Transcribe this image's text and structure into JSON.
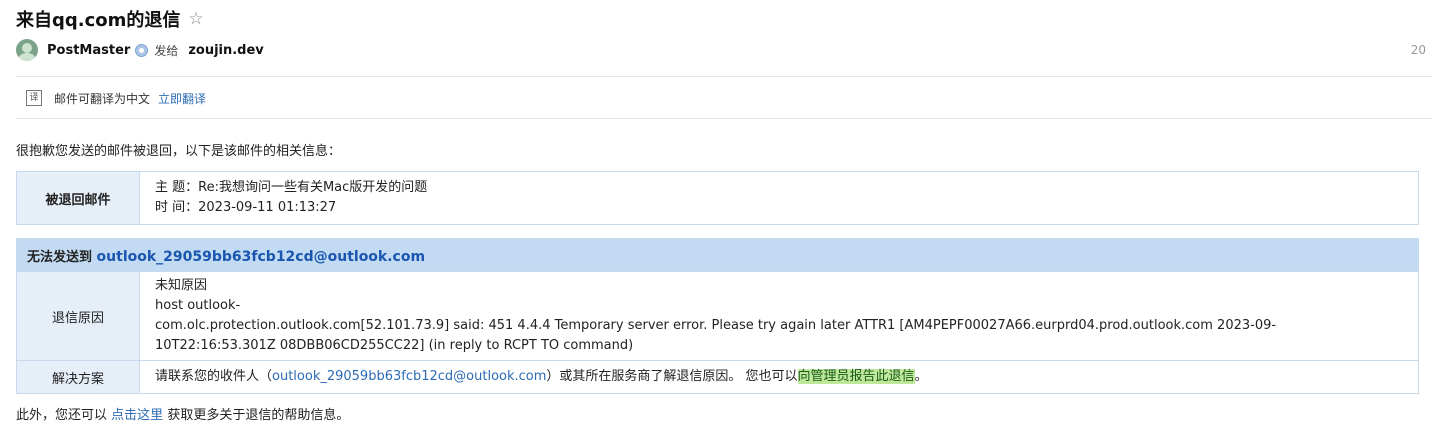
{
  "header": {
    "subject": "来自qq.com的退信",
    "star_icon": "☆",
    "sender_name": "PostMaster",
    "to_label": "发给",
    "recipient": "zoujin.dev",
    "date_partial": "20"
  },
  "translate_bar": {
    "text": "邮件可翻译为中文",
    "link": "立即翻译"
  },
  "body": {
    "intro": "很抱歉您发送的邮件被退回，以下是该邮件的相关信息：",
    "returned_mail": {
      "label": "被退回邮件",
      "subject_line": "主 题：Re:我想询问一些有关Mac版开发的问题",
      "time_line": "时 间：2023-09-11 01:13:27"
    },
    "failure": {
      "header_prefix": "无法发送到",
      "address": "outlook_29059bb63fcb12cd@outlook.com",
      "reason_label": "退信原因",
      "reason_lines": [
        "未知原因",
        "host outlook-",
        "com.olc.protection.outlook.com[52.101.73.9] said: 451 4.4.4 Temporary server error. Please try again later ATTR1 [AM4PEPF00027A66.eurprd04.prod.outlook.com 2023-09-",
        "10T22:16:53.301Z 08DBB06CD255CC22] (in reply to RCPT TO command)"
      ],
      "solution_label": "解决方案",
      "solution_prefix": "请联系您的收件人（",
      "solution_address": "outlook_29059bb63fcb12cd@outlook.com",
      "solution_middle": "）或其所在服务商了解退信原因。 您也可以",
      "solution_link": "向管理员报告此退信",
      "solution_end": "。"
    },
    "footer_prefix": "此外，您还可以",
    "footer_link": "点击这里",
    "footer_suffix": "获取更多关于退信的帮助信息。"
  },
  "colors": {
    "link": "#2d6cb5",
    "table_border": "#c9d9ec",
    "table_header_bg": "#c2dbf2",
    "highlight_bg": "#bfe89a"
  }
}
